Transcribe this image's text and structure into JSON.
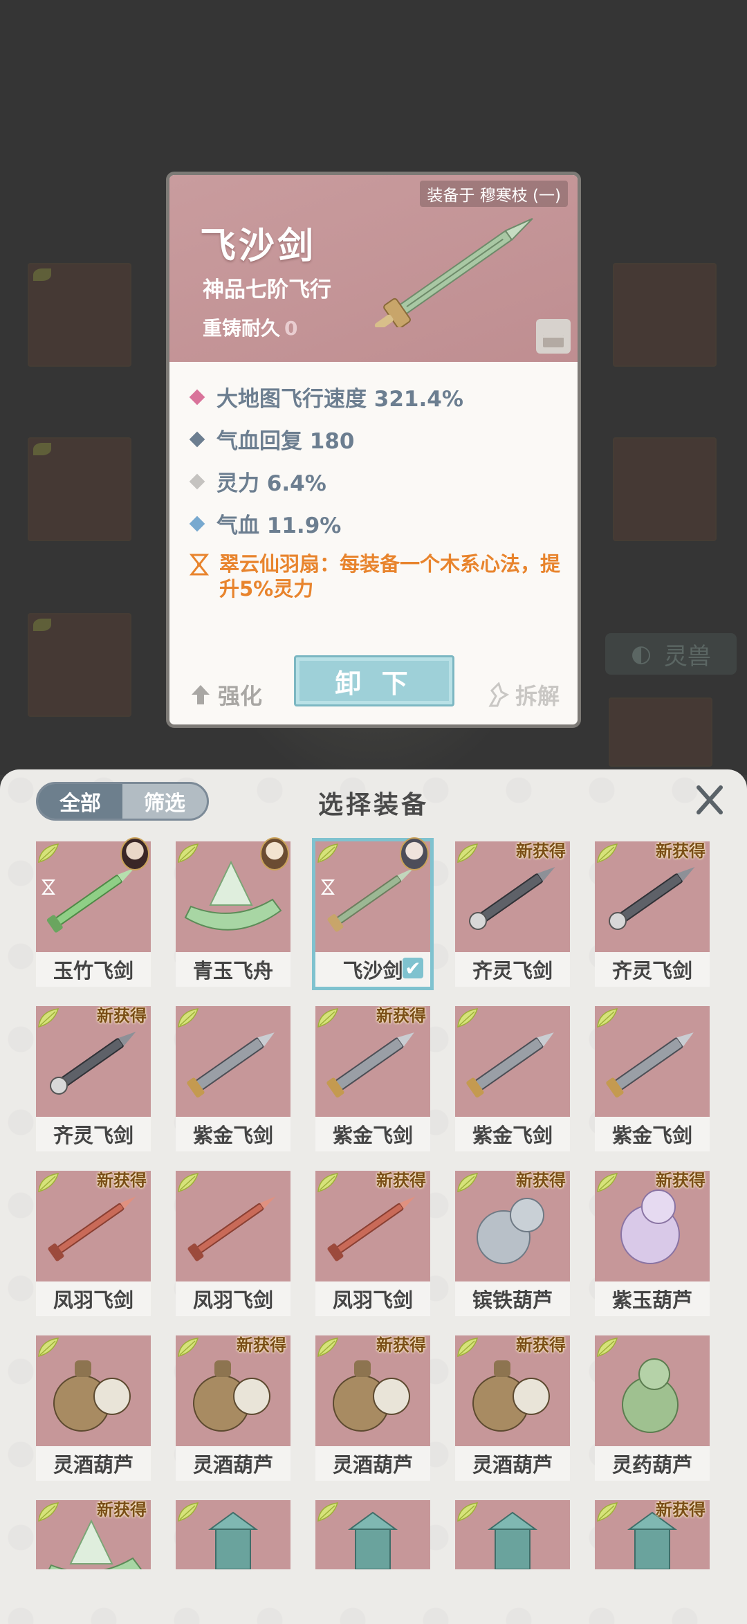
{
  "detail": {
    "equipped_on": "装备于 穆寒枝 (一)",
    "name": "飞沙剑",
    "grade": "神品七阶飞行",
    "recast_label": "重铸耐久",
    "recast_value": "0",
    "stats": [
      {
        "text": "大地图飞行速度 321.4%",
        "color": "#d9739a"
      },
      {
        "text": "气血回复 180",
        "color": "#6c7e90"
      },
      {
        "text": "灵力 6.4%",
        "color": "#c5c3c0"
      },
      {
        "text": "气血 11.9%",
        "color": "#78a9cf"
      }
    ],
    "set_bonus": "翠云仙羽扇：每装备一个木系心法，提升5%灵力",
    "enhance_label": "强化",
    "unequip_label": "卸 下",
    "dismantle_label": "拆解"
  },
  "background": {
    "tab_label": "灵兽"
  },
  "panel": {
    "tab_all": "全部",
    "tab_filter": "筛选",
    "title": "选择装备",
    "new_tag": "新获得",
    "items": [
      {
        "name": "玉竹飞剑",
        "kind": "sword-green",
        "avatar": "a",
        "set": true
      },
      {
        "name": "青玉飞舟",
        "kind": "boat",
        "avatar": "b"
      },
      {
        "name": "飞沙剑",
        "kind": "sword-gold",
        "avatar": "c",
        "set": true,
        "selected": true
      },
      {
        "name": "齐灵飞剑",
        "kind": "sword-dark",
        "new": true
      },
      {
        "name": "齐灵飞剑",
        "kind": "sword-dark",
        "new": true
      },
      {
        "name": "齐灵飞剑",
        "kind": "sword-dark",
        "new": true
      },
      {
        "name": "紫金飞剑",
        "kind": "sword-silver"
      },
      {
        "name": "紫金飞剑",
        "kind": "sword-silver",
        "new": true
      },
      {
        "name": "紫金飞剑",
        "kind": "sword-silver"
      },
      {
        "name": "紫金飞剑",
        "kind": "sword-silver"
      },
      {
        "name": "凤羽飞剑",
        "kind": "sword-red",
        "new": true
      },
      {
        "name": "凤羽飞剑",
        "kind": "sword-red"
      },
      {
        "name": "凤羽飞剑",
        "kind": "sword-red",
        "new": true
      },
      {
        "name": "镔铁葫芦",
        "kind": "gourd-grey",
        "new": true
      },
      {
        "name": "紫玉葫芦",
        "kind": "gourd-purple",
        "new": true
      },
      {
        "name": "灵酒葫芦",
        "kind": "gourd-brown"
      },
      {
        "name": "灵酒葫芦",
        "kind": "gourd-brown",
        "new": true
      },
      {
        "name": "灵酒葫芦",
        "kind": "gourd-brown",
        "new": true
      },
      {
        "name": "灵酒葫芦",
        "kind": "gourd-brown",
        "new": true
      },
      {
        "name": "灵药葫芦",
        "kind": "gourd-green"
      }
    ],
    "partial_row": [
      {
        "kind": "boat",
        "new": true
      },
      {
        "kind": "tower"
      },
      {
        "kind": "tower"
      },
      {
        "kind": "tower"
      },
      {
        "kind": "tower",
        "new": true
      }
    ]
  }
}
